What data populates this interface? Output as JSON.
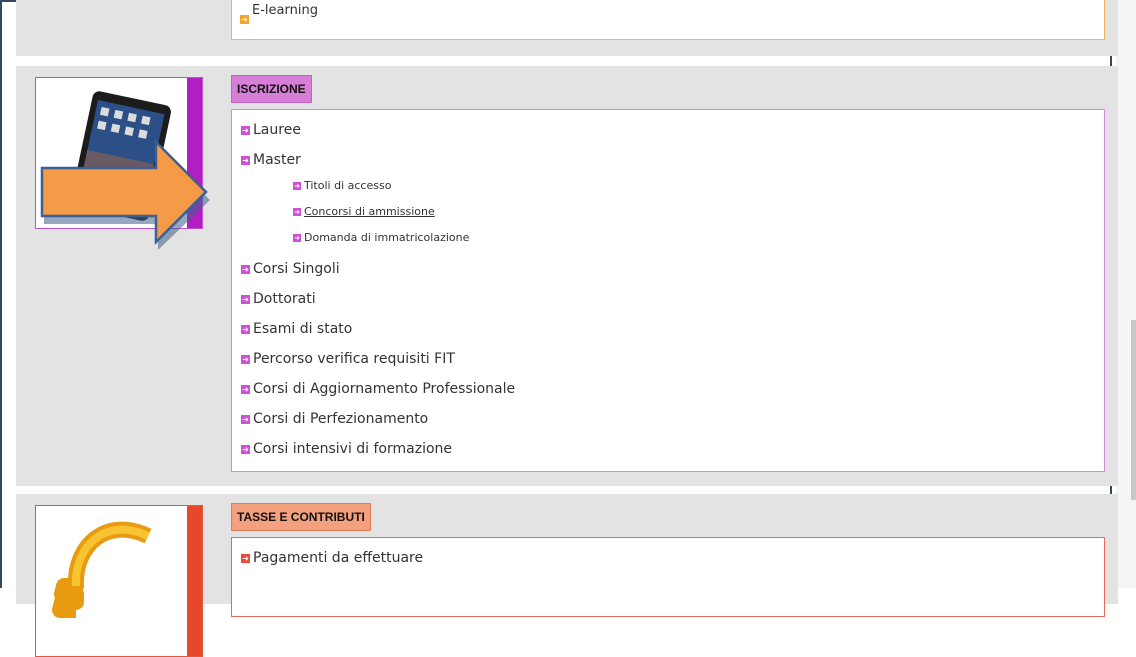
{
  "top_section": {
    "item": "E-learning"
  },
  "iscrizione": {
    "heading": "ISCRIZIONE",
    "items": [
      {
        "label": "Lauree"
      },
      {
        "label": "Master"
      },
      {
        "label": "Corsi Singoli"
      },
      {
        "label": "Dottorati"
      },
      {
        "label": "Esami di stato"
      },
      {
        "label": "Percorso verifica requisiti FIT"
      },
      {
        "label": "Corsi di Aggiornamento Professionale"
      },
      {
        "label": "Corsi di Perfezionamento"
      },
      {
        "label": "Corsi intensivi di formazione"
      }
    ],
    "master_sub": [
      {
        "label": "Titoli di accesso"
      },
      {
        "label": "Concorsi di ammissione"
      },
      {
        "label": "Domanda di immatricolazione"
      }
    ],
    "image": "tablet-icon",
    "accent": "#b11fc4"
  },
  "tasse": {
    "heading": "TASSE E CONTRIBUTI",
    "items": [
      {
        "label": "Pagamenti da effettuare"
      }
    ],
    "image": "euro-icon",
    "accent": "#e8472a"
  },
  "annotation": {
    "shape": "arrow-right",
    "color": "#f59a47"
  }
}
